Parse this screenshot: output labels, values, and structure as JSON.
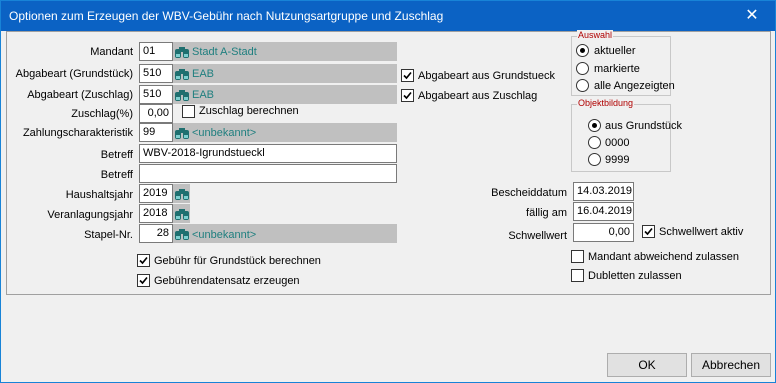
{
  "window": {
    "title": "Optionen zum Erzeugen der WBV-Gebühr nach Nutzungsartgruppe und Zuschlag"
  },
  "form": {
    "mandant": {
      "label": "Mandant",
      "value": "01",
      "text": "Stadt A-Stadt"
    },
    "abgabeart_grundstueck": {
      "label": "Abgabeart (Grundstück)",
      "value": "510",
      "text": "EAB"
    },
    "abgabeart_zuschlag": {
      "label": "Abgabeart (Zuschlag)",
      "value": "510",
      "text": "EAB"
    },
    "zuschlag": {
      "label": "Zuschlag(%)",
      "value": "0,00"
    },
    "zuschlag_berechnen": {
      "label": "Zuschlag berechnen",
      "checked": false
    },
    "zahlungscharakteristik": {
      "label": "Zahlungscharakteristik",
      "value": "99",
      "text": "<unbekannt>"
    },
    "betreff1": {
      "label": "Betreff",
      "value": "WBV-2018-Igrundstueckl"
    },
    "betreff2": {
      "label": "Betreff",
      "value": ""
    },
    "haushaltsjahr": {
      "label": "Haushaltsjahr",
      "value": "2019"
    },
    "veranlagungsjahr": {
      "label": "Veranlagungsjahr",
      "value": "2018"
    },
    "stapel_nr": {
      "label": "Stapel-Nr.",
      "value": "28",
      "text": "<unbekannt>"
    },
    "abgabeart_aus_grundstueck": {
      "label": "Abgabeart aus Grundstueck",
      "checked": true
    },
    "abgabeart_aus_zuschlag": {
      "label": "Abgabeart aus Zuschlag",
      "checked": true
    },
    "gebuehr_berechnen": {
      "label": "Gebühr für Grundstück berechnen",
      "checked": true
    },
    "gebuehrendatensatz": {
      "label": "Gebührendatensatz erzeugen",
      "checked": true
    },
    "bescheiddatum": {
      "label": "Bescheiddatum",
      "value": "14.03.2019"
    },
    "faellig_am": {
      "label": "fällig am",
      "value": "16.04.2019"
    },
    "schwellwert": {
      "label": "Schwellwert",
      "value": "0,00"
    },
    "schwellwert_aktiv": {
      "label": "Schwellwert aktiv",
      "checked": true
    },
    "mandant_abweichend": {
      "label": "Mandant abweichend zulassen",
      "checked": false
    },
    "dubletten": {
      "label": "Dubletten zulassen",
      "checked": false
    }
  },
  "auswahl": {
    "title": "Auswahl",
    "options": [
      "aktueller",
      "markierte",
      "alle Angezeigten"
    ],
    "selected": 0
  },
  "objektbildung": {
    "title": "Objektbildung",
    "options": [
      "aus Grundstück",
      "0000",
      "9999"
    ],
    "selected": 0
  },
  "buttons": {
    "ok": "OK",
    "abbrechen": "Abbrechen"
  },
  "icons": {
    "lookup": "binoculars-icon",
    "close": "close-icon"
  }
}
